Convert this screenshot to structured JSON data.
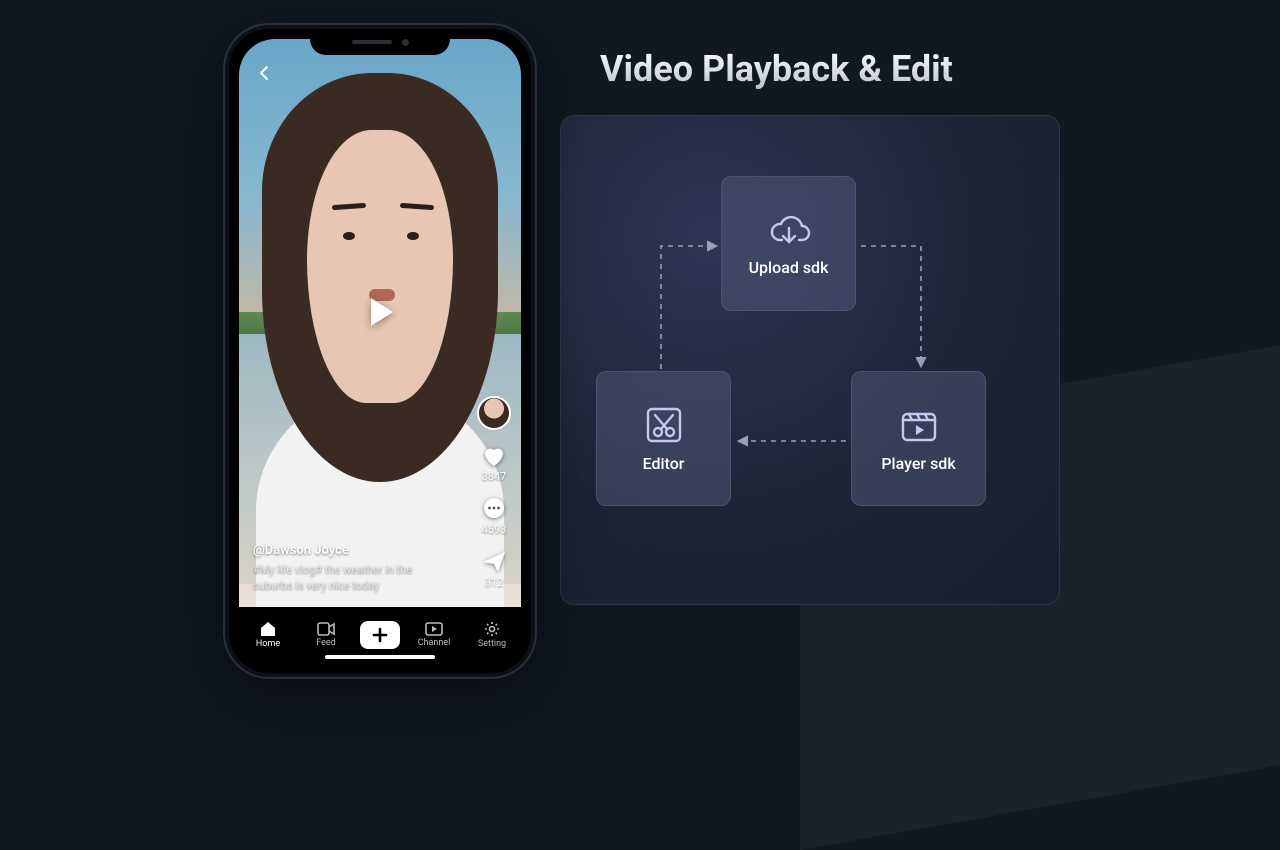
{
  "heading": "Video Playback & Edit",
  "diagram": {
    "upload_label": "Upload sdk",
    "editor_label": "Editor",
    "player_label": "Player sdk"
  },
  "phone": {
    "feed": {
      "username": "@Dawson Joyce",
      "caption": "#My life vlog# the weather in the suburbs is very nice today",
      "like_count": "3847",
      "comment_count": "4593",
      "share_count": "312"
    },
    "tabs": {
      "home": "Home",
      "feed": "Feed",
      "channel": "Channel",
      "setting": "Setting"
    }
  }
}
